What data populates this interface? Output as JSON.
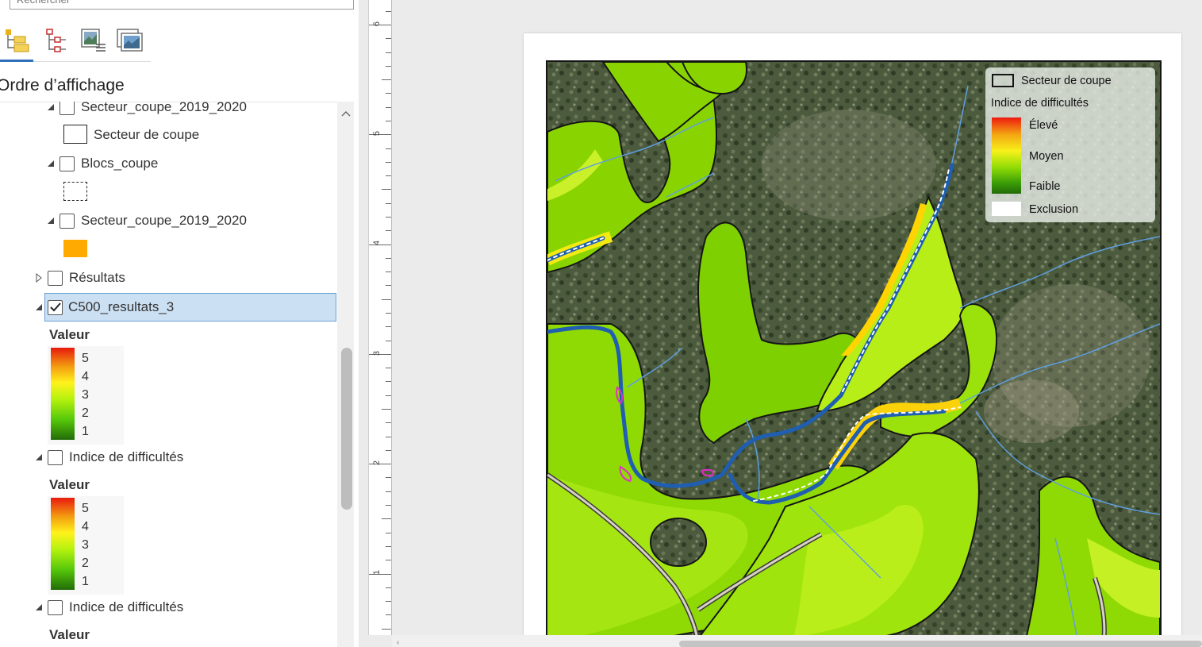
{
  "search": {
    "placeholder": "Rechercher"
  },
  "contents": {
    "title": "Ordre d’affichage",
    "tabs": [
      {
        "name": "drawing-order",
        "active": true
      },
      {
        "name": "data-source",
        "active": false
      },
      {
        "name": "selection",
        "active": false
      },
      {
        "name": "editing",
        "active": false
      }
    ],
    "layers": {
      "secteur_top": "Secteur_coupe_2019_2020",
      "secteur_symbol": "Secteur de coupe",
      "blocs": "Blocs_coupe",
      "secteur_2": "Secteur_coupe_2019_2020",
      "resultats": "Résultats",
      "c500": "C500_resultats_3",
      "indice_1": "Indice de difficultés",
      "indice_2": "Indice de difficultés"
    },
    "legend1": {
      "title": "Valeur",
      "labels": [
        "5",
        "4",
        "3",
        "2",
        "1"
      ]
    },
    "legend2": {
      "title": "Valeur",
      "labels": [
        "5",
        "4",
        "3",
        "2",
        "1"
      ]
    },
    "legend3": {
      "title": "Valeur"
    },
    "colors": {
      "secteur_fill": "#ffaa00",
      "selection": "#cce0f3"
    }
  },
  "ruler": {
    "labels": [
      "6",
      "5",
      "4",
      "3",
      "2",
      "1"
    ]
  },
  "map_legend": {
    "secteur": "Secteur de coupe",
    "indice_title": "Indice de difficultés",
    "eleve": "Élevé",
    "moyen": "Moyen",
    "faible": "Faible",
    "exclusion": "Exclusion"
  }
}
